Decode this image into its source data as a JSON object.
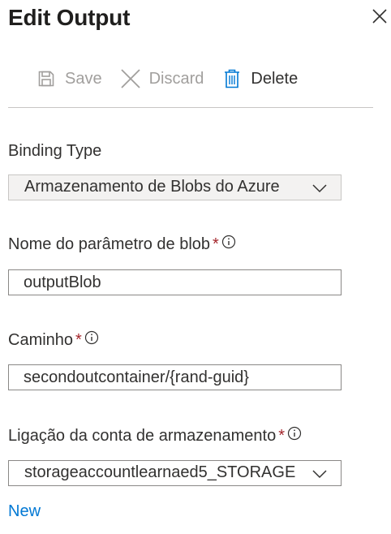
{
  "header": {
    "title": "Edit Output"
  },
  "toolbar": {
    "save_label": "Save",
    "discard_label": "Discard",
    "delete_label": "Delete"
  },
  "icons": {
    "close": "close-icon",
    "save": "save-icon",
    "discard": "discard-icon",
    "delete": "trash-icon",
    "info": "info-icon",
    "dropdown": "chevron-down-icon"
  },
  "colors": {
    "required": "#a4262c",
    "link": "#0078d4",
    "disabled_text": "#a19f9d",
    "border": "#8a8886"
  },
  "form": {
    "binding_type": {
      "label": "Binding Type",
      "value": "Armazenamento de Blobs do Azure"
    },
    "blob_parameter_name": {
      "label": "Nome do parâmetro de blob",
      "required_mark": "*",
      "value": "outputBlob"
    },
    "path": {
      "label": "Caminho",
      "required_mark": "*",
      "value": "secondoutcontainer/{rand-guid}"
    },
    "storage_account_connection": {
      "label": "Ligação da conta de armazenamento",
      "required_mark": "*",
      "value": "storageaccountlearnaed5_STORAGE",
      "new_link": "New"
    }
  }
}
